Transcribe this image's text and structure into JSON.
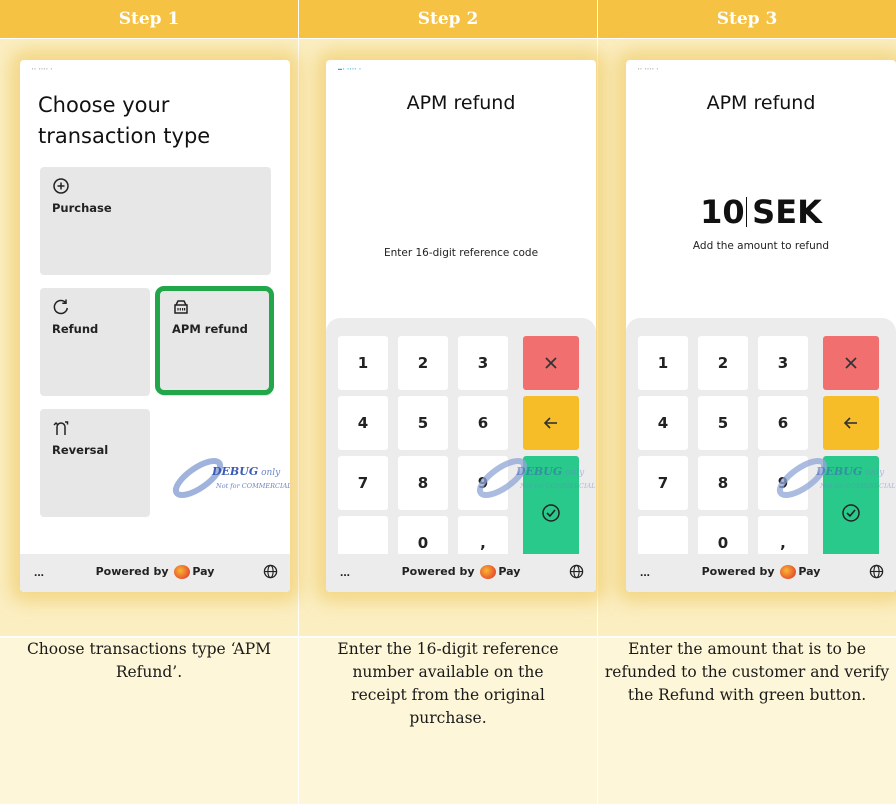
{
  "headers": [
    "Step 1",
    "Step 2",
    "Step 3"
  ],
  "colors": {
    "header": "#f6c244",
    "highlight": "#21a64a",
    "key_clear": "#f26f6f",
    "key_back": "#f6bd28",
    "key_ok": "#28c98b"
  },
  "screen1": {
    "title_line1": "Choose your",
    "title_line2": "transaction type",
    "tiles": [
      {
        "label": "Purchase",
        "icon": "plus-circle-icon"
      },
      {
        "label": "Refund",
        "icon": "refresh-icon"
      },
      {
        "label": "APM refund",
        "icon": "wallet-icon"
      },
      {
        "label": "Reversal",
        "icon": "reversal-icon"
      }
    ]
  },
  "screen2": {
    "title": "APM refund",
    "prompt": "Enter 16-digit reference code"
  },
  "screen3": {
    "title": "APM refund",
    "amount_value": "10",
    "amount_currency": "SEK",
    "prompt": "Add the amount to refund"
  },
  "keypad": [
    "1",
    "2",
    "3",
    "4",
    "5",
    "6",
    "7",
    "8",
    "9",
    "0",
    ","
  ],
  "footer": {
    "more": "...",
    "powered_prefix": "Powered by",
    "powered_brand": "Pay"
  },
  "watermark": {
    "line1": "DEBUG",
    "line1b": " only",
    "line2": "Not for COMMERCIAL"
  },
  "descriptions": [
    "Choose transactions type ‘APM Refund’.",
    "Enter the 16-digit reference number available on the receipt from the original purchase.",
    "Enter the amount that is to be refunded to the customer and verify the Refund with green button."
  ]
}
